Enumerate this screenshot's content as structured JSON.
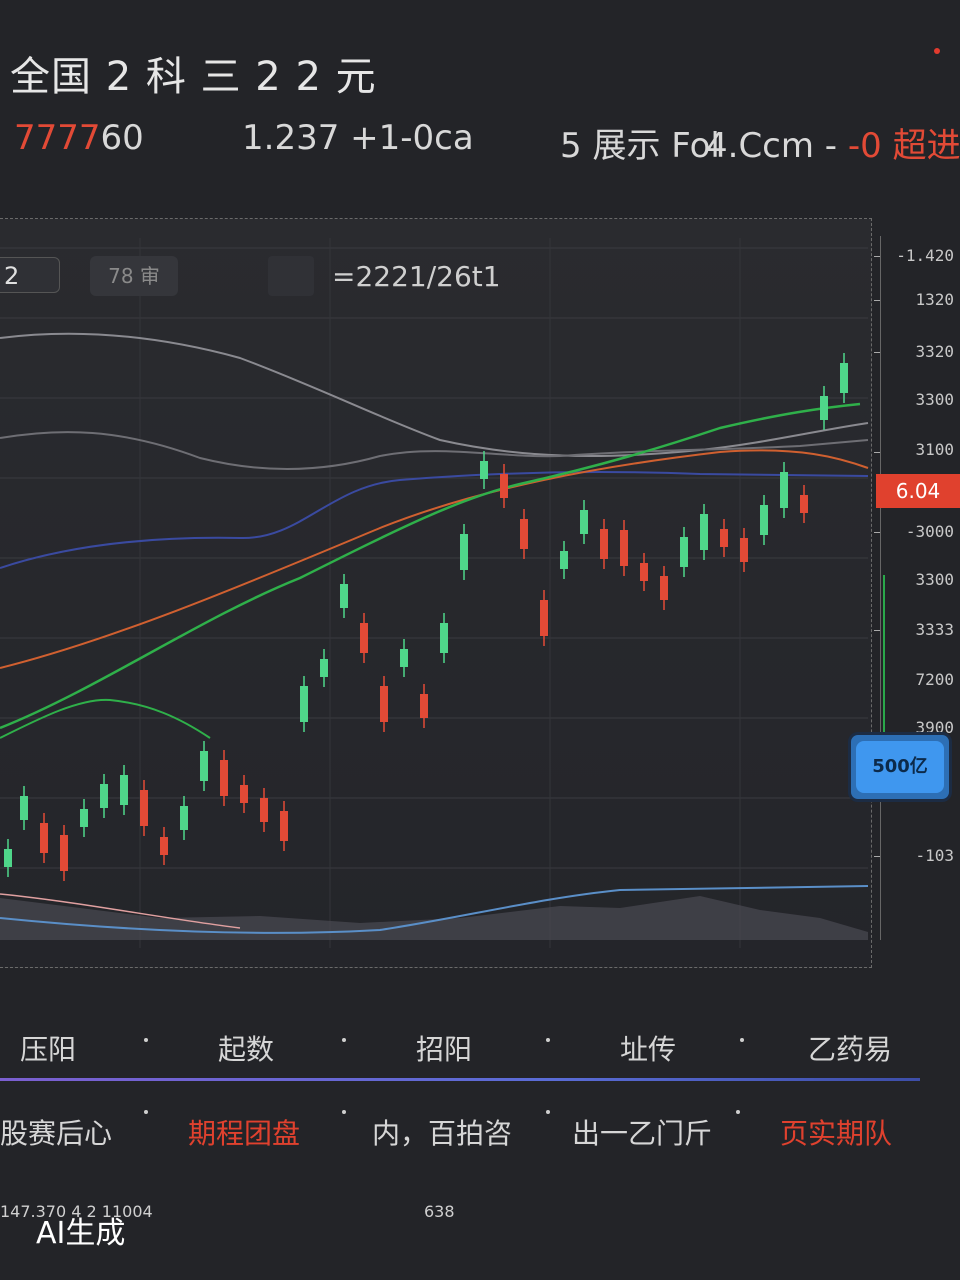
{
  "header": {
    "title": "全国 2 科 三 2 2 元",
    "stats": [
      {
        "hl": "7777",
        "rest": "60"
      },
      {
        "hl": "",
        "rest": "1.237  +1-0ca"
      },
      {
        "hl": "",
        "rest": "5 展示 Fol"
      },
      {
        "hl": "",
        "rest": "4.Ccm - -0 超进",
        "hl_tail": "-0 超进"
      }
    ]
  },
  "chart_toolbar": {
    "chip_a": "2",
    "chip_b": "78 审",
    "range": "=2221/26t1"
  },
  "price_axis": {
    "ticks": [
      "-1.420",
      "1320",
      "3320",
      "3300",
      "3100",
      "-3000",
      "3300",
      "3333",
      "7200",
      "3900",
      "-103"
    ],
    "current_price": "6.04",
    "highlight": "500亿"
  },
  "nav": {
    "items": [
      "压阳",
      "起数",
      "招阳",
      "址传",
      "乙药易"
    ]
  },
  "info": {
    "items": [
      {
        "text": "股赛后心",
        "color": "#d6d6d6"
      },
      {
        "text": "期程团盘",
        "color": "#e0412e"
      },
      {
        "text": "内，百拍咨",
        "color": "#d6d6d6"
      },
      {
        "text": "出一乙门斤",
        "color": "#d6d6d6"
      },
      {
        "text": "页实期队",
        "color": "#e0412e"
      }
    ]
  },
  "footer": {
    "left": "147.370 4 2 11004",
    "mid": "638",
    "watermark": "AI生成"
  },
  "colors": {
    "up": "#4fd68a",
    "down": "#e24a36",
    "accent_blue": "#3f97ef",
    "background": "#232428"
  }
}
